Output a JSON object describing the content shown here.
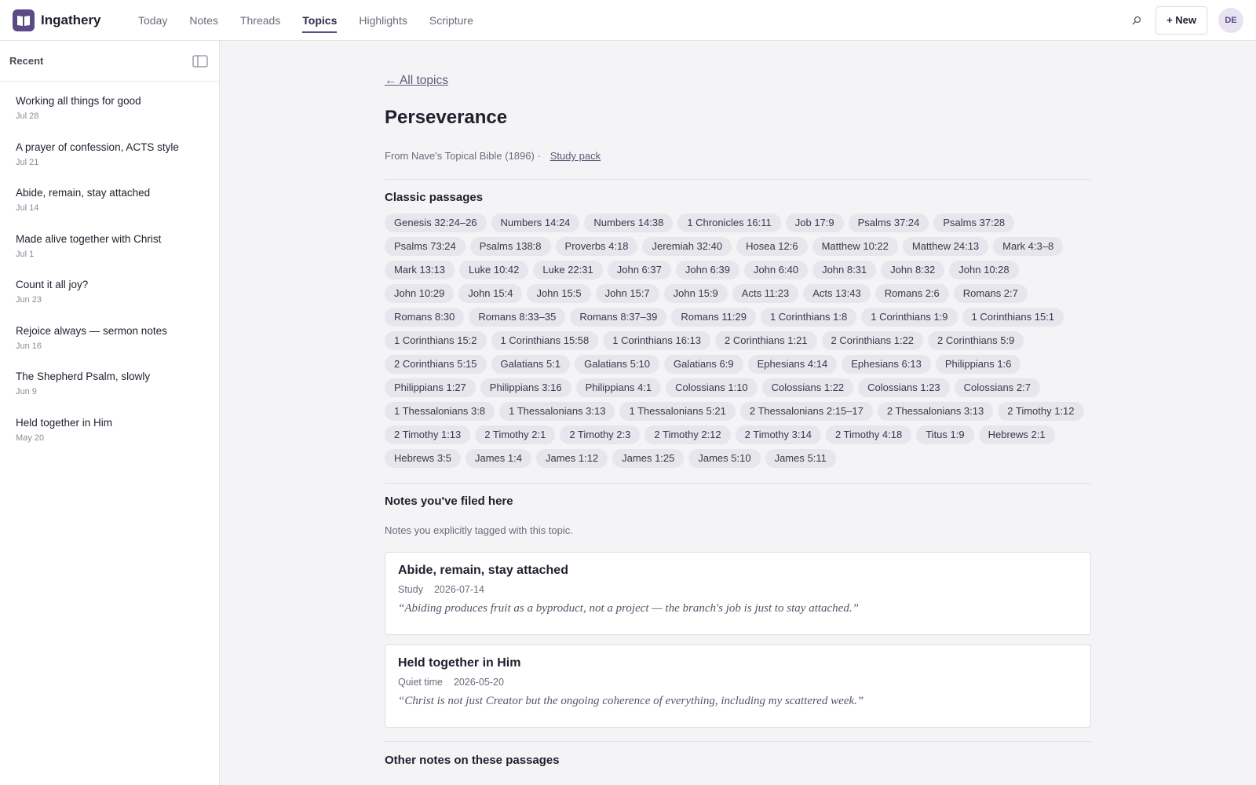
{
  "brand": {
    "name": "Ingathery"
  },
  "nav": {
    "items": [
      {
        "label": "Today",
        "active": false
      },
      {
        "label": "Notes",
        "active": false
      },
      {
        "label": "Threads",
        "active": false
      },
      {
        "label": "Topics",
        "active": true
      },
      {
        "label": "Highlights",
        "active": false
      },
      {
        "label": "Scripture",
        "active": false
      }
    ]
  },
  "topbar": {
    "new_label": "+ New",
    "avatar_initials": "DE"
  },
  "sidebar": {
    "title": "Recent",
    "items": [
      {
        "title": "Working all things for good",
        "date": "Jul 28"
      },
      {
        "title": "A prayer of confession, ACTS style",
        "date": "Jul 21"
      },
      {
        "title": "Abide, remain, stay attached",
        "date": "Jul 14"
      },
      {
        "title": "Made alive together with Christ",
        "date": "Jul 1"
      },
      {
        "title": "Count it all joy?",
        "date": "Jun 23"
      },
      {
        "title": "Rejoice always — sermon notes",
        "date": "Jun 16"
      },
      {
        "title": "The Shepherd Psalm, slowly",
        "date": "Jun 9"
      },
      {
        "title": "Held together in Him",
        "date": "May 20"
      }
    ]
  },
  "topic": {
    "back_label": "← All topics",
    "title": "Perseverance",
    "source": "From Nave's Topical Bible (1896) ·",
    "study_pack_label": "Study pack"
  },
  "classic": {
    "title": "Classic passages",
    "passages": [
      "Genesis 32:24–26",
      "Numbers 14:24",
      "Numbers 14:38",
      "1 Chronicles 16:11",
      "Job 17:9",
      "Psalms 37:24",
      "Psalms 37:28",
      "Psalms 73:24",
      "Psalms 138:8",
      "Proverbs 4:18",
      "Jeremiah 32:40",
      "Hosea 12:6",
      "Matthew 10:22",
      "Matthew 24:13",
      "Mark 4:3–8",
      "Mark 13:13",
      "Luke 10:42",
      "Luke 22:31",
      "John 6:37",
      "John 6:39",
      "John 6:40",
      "John 8:31",
      "John 8:32",
      "John 10:28",
      "John 10:29",
      "John 15:4",
      "John 15:5",
      "John 15:7",
      "John 15:9",
      "Acts 11:23",
      "Acts 13:43",
      "Romans 2:6",
      "Romans 2:7",
      "Romans 8:30",
      "Romans 8:33–35",
      "Romans 8:37–39",
      "Romans 11:29",
      "1 Corinthians 1:8",
      "1 Corinthians 1:9",
      "1 Corinthians 15:1",
      "1 Corinthians 15:2",
      "1 Corinthians 15:58",
      "1 Corinthians 16:13",
      "2 Corinthians 1:21",
      "2 Corinthians 1:22",
      "2 Corinthians 5:9",
      "2 Corinthians 5:15",
      "Galatians 5:1",
      "Galatians 5:10",
      "Galatians 6:9",
      "Ephesians 4:14",
      "Ephesians 6:13",
      "Philippians 1:6",
      "Philippians 1:27",
      "Philippians 3:16",
      "Philippians 4:1",
      "Colossians 1:10",
      "Colossians 1:22",
      "Colossians 1:23",
      "Colossians 2:7",
      "1 Thessalonians 3:8",
      "1 Thessalonians 3:13",
      "1 Thessalonians 5:21",
      "2 Thessalonians 2:15–17",
      "2 Thessalonians 3:13",
      "2 Timothy 1:12",
      "2 Timothy 1:13",
      "2 Timothy 2:1",
      "2 Timothy 2:3",
      "2 Timothy 2:12",
      "2 Timothy 3:14",
      "2 Timothy 4:18",
      "Titus 1:9",
      "Hebrews 2:1",
      "Hebrews 3:5",
      "James 1:4",
      "James 1:12",
      "James 1:25",
      "James 5:10",
      "James 5:11"
    ]
  },
  "filed": {
    "title": "Notes you've filed here",
    "subtitle": "Notes you explicitly tagged with this topic.",
    "notes": [
      {
        "title": "Abide, remain, stay attached",
        "kind": "Study",
        "date": "2026-07-14",
        "quote": "“Abiding produces fruit as a byproduct, not a project — the branch's job is just to stay attached.”"
      },
      {
        "title": "Held together in Him",
        "kind": "Quiet time",
        "date": "2026-05-20",
        "quote": "“Christ is not just Creator but the ongoing coherence of everything, including my scattered week.”"
      }
    ]
  },
  "other": {
    "title": "Other notes on these passages"
  },
  "colors": {
    "accent": "#5b4a86",
    "chip_bg": "#e6e6ec",
    "border": "#dedee4"
  },
  "icons": {
    "brand": "book-icon",
    "search": "search-icon",
    "sidebar_toggle": "sidebar-toggle-icon"
  }
}
